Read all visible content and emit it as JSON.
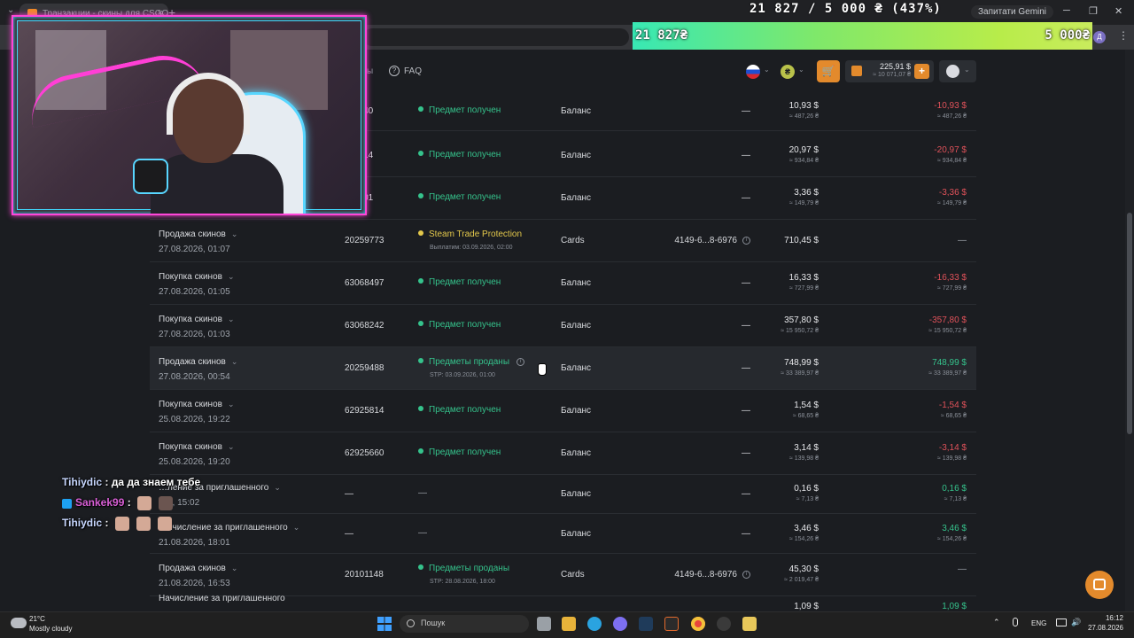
{
  "browser": {
    "tab_title": "Транзакции - скины для CSGO",
    "gemini_label": "Запитати Gemini",
    "profile_letter": "Д"
  },
  "goal": {
    "text": "21 827 / 5 000 ₴ (437%)",
    "current": "21 827₴",
    "target": "5 000₴",
    "progress_percent": 437,
    "colors": [
      "#38e8b4",
      "#c9ec5d"
    ]
  },
  "site_header": {
    "nav_partial": "ы",
    "faq_label": "FAQ",
    "balance_main": "225,91 $",
    "balance_sub": "≈ 10 071,07 ₴",
    "accent_color": "#e38a2c"
  },
  "rows": [
    {
      "id": "…0240",
      "status": "Предмет получен",
      "method": "Баланс",
      "account": "—",
      "amount": "10,93 $",
      "amount_sub": "≈ 487,26 ₴",
      "change": "-10,93 $",
      "change_sub": "≈ 487,26 ₴",
      "change_kind": "neg"
    },
    {
      "id": "…9814",
      "status": "Предмет получен",
      "method": "Баланс",
      "account": "—",
      "amount": "20,97 $",
      "amount_sub": "≈ 934,84 ₴",
      "change": "-20,97 $",
      "change_sub": "≈ 934,84 ₴",
      "change_kind": "neg"
    },
    {
      "id": "…9301",
      "status": "Предмет получен",
      "method": "Баланс",
      "account": "—",
      "amount": "3,36 $",
      "amount_sub": "≈ 149,79 ₴",
      "change": "-3,36 $",
      "change_sub": "≈ 149,79 ₴",
      "change_kind": "neg"
    },
    {
      "type": "Продажа скинов",
      "date": "27.08.2026, 01:07",
      "id": "20259773",
      "status": "Steam Trade Protection",
      "status_kind": "warn",
      "substatus": "Выплатим: 03.09.2026, 02:00",
      "method": "Cards",
      "account": "4149-6...8-6976",
      "amount": "710,45 $",
      "change": "—",
      "change_kind": "none"
    },
    {
      "type": "Покупка скинов",
      "date": "27.08.2026, 01:05",
      "id": "63068497",
      "status": "Предмет получен",
      "method": "Баланс",
      "account": "—",
      "amount": "16,33 $",
      "amount_sub": "≈ 727,99 ₴",
      "change": "-16,33 $",
      "change_sub": "≈ 727,99 ₴",
      "change_kind": "neg"
    },
    {
      "type": "Покупка скинов",
      "date": "27.08.2026, 01:03",
      "id": "63068242",
      "status": "Предмет получен",
      "method": "Баланс",
      "account": "—",
      "amount": "357,80 $",
      "amount_sub": "≈ 15 950,72 ₴",
      "change": "-357,80 $",
      "change_sub": "≈ 15 950,72 ₴",
      "change_kind": "neg"
    },
    {
      "type": "Продажа скинов",
      "date": "27.08.2026, 00:54",
      "id": "20259488",
      "status": "Предметы проданы",
      "substatus": "STP: 03.09.2026, 01:00",
      "method": "Баланс",
      "account": "—",
      "amount": "748,99 $",
      "amount_sub": "≈ 33 389,97 ₴",
      "change": "748,99 $",
      "change_sub": "≈ 33 389,97 ₴",
      "change_kind": "pos"
    },
    {
      "type": "Покупка скинов",
      "date": "25.08.2026, 19:22",
      "id": "62925814",
      "status": "Предмет получен",
      "method": "Баланс",
      "account": "—",
      "amount": "1,54 $",
      "amount_sub": "≈ 68,65 ₴",
      "change": "-1,54 $",
      "change_sub": "≈ 68,65 ₴",
      "change_kind": "neg"
    },
    {
      "type": "Покупка скинов",
      "date": "25.08.2026, 19:20",
      "id": "62925660",
      "status": "Предмет получен",
      "method": "Баланс",
      "account": "—",
      "amount": "3,14 $",
      "amount_sub": "≈ 139,98 ₴",
      "change": "-3,14 $",
      "change_sub": "≈ 139,98 ₴",
      "change_kind": "neg"
    },
    {
      "type": "…ление за приглашенного",
      "date": "2…, 15:02",
      "id": "—",
      "status": "—",
      "method": "Баланс",
      "account": "—",
      "amount": "0,16 $",
      "amount_sub": "≈ 7,13 ₴",
      "change": "0,16 $",
      "change_sub": "≈ 7,13 ₴",
      "change_kind": "pos"
    },
    {
      "type": "…ичисление за приглашенного",
      "date": "21.08.2026, 18:01",
      "id": "—",
      "status": "—",
      "method": "Баланс",
      "account": "—",
      "amount": "3,46 $",
      "amount_sub": "≈ 154,26 ₴",
      "change": "3,46 $",
      "change_sub": "≈ 154,26 ₴",
      "change_kind": "pos"
    },
    {
      "type": "Продажа скинов",
      "date": "21.08.2026, 16:53",
      "id": "20101148",
      "status": "Предметы проданы",
      "substatus": "STP: 28.08.2026, 18:00",
      "method": "Cards",
      "account": "4149-6...8-6976",
      "amount": "45,30 $",
      "amount_sub": "≈ 2 019,47 ₴",
      "change": "—",
      "change_kind": "none"
    },
    {
      "type": "Начисление за приглашенного",
      "amount": "1,09 $",
      "change": "1,09 $",
      "change_kind": "pos"
    }
  ],
  "chat": [
    {
      "user": "Tihiydic",
      "sep": ":",
      "message": "да да знаем тебе"
    },
    {
      "user": "Sankek99",
      "sep": ":"
    },
    {
      "user": "Tihiydic",
      "sep": ":"
    }
  ],
  "taskbar": {
    "weather_temp": "21°C",
    "weather_desc": "Mostly cloudy",
    "search_placeholder": "Пошук",
    "lang": "ENG",
    "time": "16:12",
    "date": "27.08.2026"
  }
}
